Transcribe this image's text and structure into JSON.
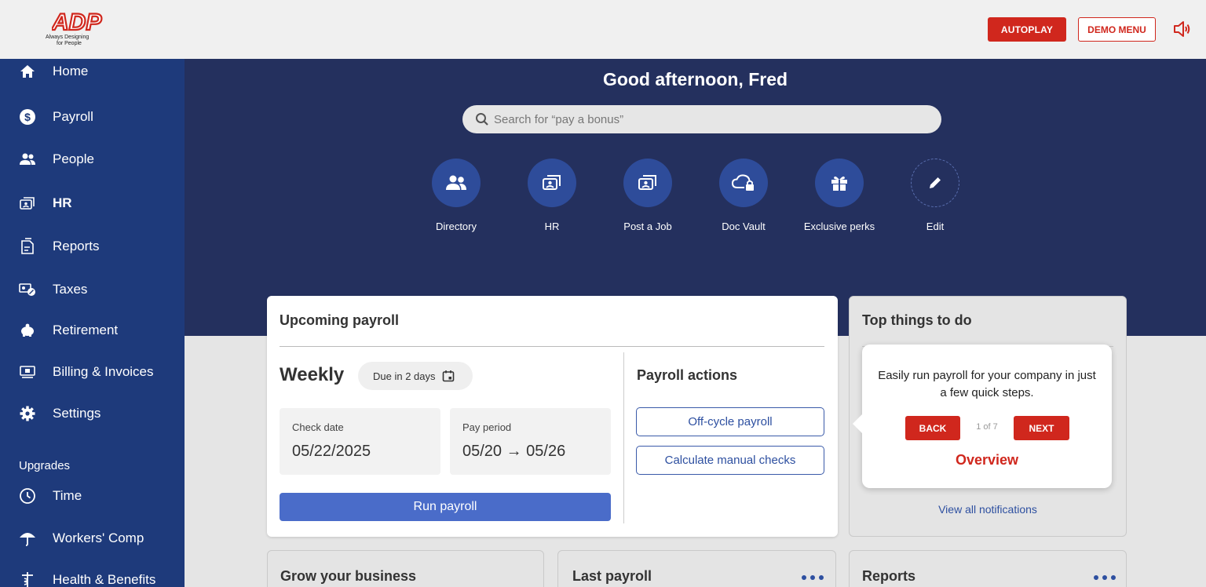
{
  "brand": {
    "logo_text": "ADP",
    "tagline_line1": "Always Designing",
    "tagline_line2": "for People"
  },
  "topbar": {
    "autoplay_label": "AUTOPLAY",
    "demo_menu_label": "DEMO MENU"
  },
  "sidebar": {
    "items": [
      {
        "label": "Home",
        "icon": "home-icon"
      },
      {
        "label": "Payroll",
        "icon": "dollar-icon"
      },
      {
        "label": "People",
        "icon": "people-icon"
      },
      {
        "label": "HR",
        "icon": "hr-icon"
      },
      {
        "label": "Reports",
        "icon": "reports-icon"
      },
      {
        "label": "Taxes",
        "icon": "taxes-icon"
      },
      {
        "label": "Retirement",
        "icon": "piggy-bank-icon"
      },
      {
        "label": "Billing & Invoices",
        "icon": "billing-icon"
      },
      {
        "label": "Settings",
        "icon": "gear-icon"
      }
    ],
    "upgrades_label": "Upgrades",
    "upgrade_items": [
      {
        "label": "Time",
        "icon": "clock-icon"
      },
      {
        "label": "Workers' Comp",
        "icon": "umbrella-icon"
      },
      {
        "label": "Health & Benefits",
        "icon": "caduceus-icon"
      }
    ]
  },
  "hero": {
    "greeting": "Good afternoon, Fred",
    "search_placeholder": "Search for “pay a bonus”",
    "quick_actions": [
      {
        "label": "Directory",
        "icon": "directory-icon"
      },
      {
        "label": "HR",
        "icon": "hr-icon"
      },
      {
        "label": "Post a Job",
        "icon": "post-job-icon"
      },
      {
        "label": "Doc Vault",
        "icon": "cloud-lock-icon"
      },
      {
        "label": "Exclusive perks",
        "icon": "gift-icon"
      },
      {
        "label": "Edit",
        "icon": "pencil-icon"
      }
    ]
  },
  "payroll_card": {
    "title": "Upcoming payroll",
    "frequency": "Weekly",
    "due": "Due in 2 days",
    "check_date_label": "Check date",
    "check_date_value": "05/22/2025",
    "pay_period_label": "Pay period",
    "pay_period_value": "05/20 → 05/26",
    "run_label": "Run payroll",
    "actions_title": "Payroll actions",
    "action_offcycle": "Off-cycle payroll",
    "action_manual": "Calculate manual checks"
  },
  "todo_card": {
    "title": "Top things to do",
    "view_all": "View all notifications"
  },
  "tooltip": {
    "text": "Easily run payroll for your company in just a few quick steps.",
    "back_label": "BACK",
    "counter": "1 of 7",
    "next_label": "NEXT",
    "title": "Overview"
  },
  "bottom_cards": {
    "grow": "Grow your business",
    "last_payroll": "Last payroll",
    "reports": "Reports"
  },
  "colors": {
    "brand_red": "#d0271d",
    "sidebar_blue": "#1e3a7b",
    "hero_navy": "#24305e",
    "primary_blue": "#4a6cc9"
  }
}
